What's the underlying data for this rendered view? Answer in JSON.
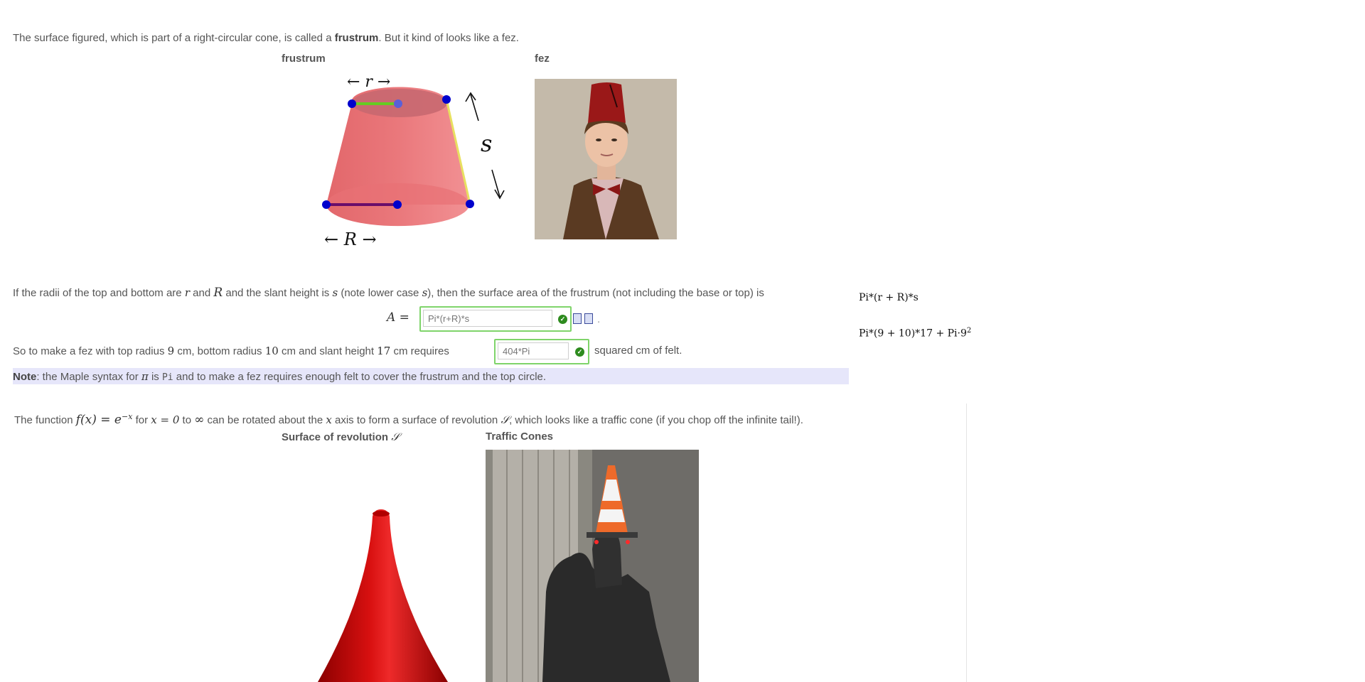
{
  "intro": {
    "before": "The surface figured, which is part of a right-circular cone, is called a ",
    "bold": "frustrum",
    "after": ". But it kind of looks like a fez."
  },
  "figure1": {
    "caption_left": "frustrum",
    "caption_right": "fez",
    "label_top": "← r →",
    "label_bottom": "← R →",
    "label_slant": "s",
    "colors": {
      "cone": "#e8686b",
      "top_radius": "#66cc22",
      "bottom_radius": "#6a0d6a",
      "points": "#0000cc",
      "slant": "#e8e060"
    }
  },
  "formula": {
    "text1": "If the radii of the top and bottom are ",
    "r": "r",
    "text2": " and ",
    "R": "R",
    "text3": " and the slant height is ",
    "s": "s",
    "text4": " (note lower case ",
    "s2": "s",
    "text5": "), then the surface area of the frustrum (not including the base or top) is",
    "lhs": "A =",
    "input_placeholder": "Pi*(r+R)*s",
    "trailing": "."
  },
  "fez": {
    "text1": "So to make a fez with top radius ",
    "top": "9",
    "text2": " cm, bottom radius ",
    "bottom": "10",
    "text3": " cm and slant height ",
    "slant": "17",
    "text4": " cm requires",
    "input_placeholder": "404*Pi",
    "text5": "squared cm of felt."
  },
  "note": {
    "bold": "Note",
    "text1": ": the Maple syntax for ",
    "pi": "π",
    "text2": " is ",
    "code": "Pi",
    "text3": " and to make a fez requires enough felt to cover the frustrum and the top circle."
  },
  "preview": {
    "line1": "Pi*(r + R)*s",
    "line2_main": "Pi*(9 + 10)*17 + Pi·9",
    "line2_sup": "2"
  },
  "revolution": {
    "text1": "The function ",
    "func": "f(x) = e",
    "exp": "−x",
    "text2": " for ",
    "xeq": "x = 0",
    "text3": " to ",
    "inf": "∞",
    "text4": " can be rotated about the ",
    "x": "x",
    "text5": " axis to form a surface of revolution ",
    "S": "𝒮",
    "text6": ", which looks like a traffic cone (if you chop off the infinite tail!).",
    "caption_left": "Surface of revolution ",
    "caption_left_S": "𝒮",
    "caption_right": "Traffic Cones",
    "colors": {
      "surface": "#cc0000"
    }
  }
}
